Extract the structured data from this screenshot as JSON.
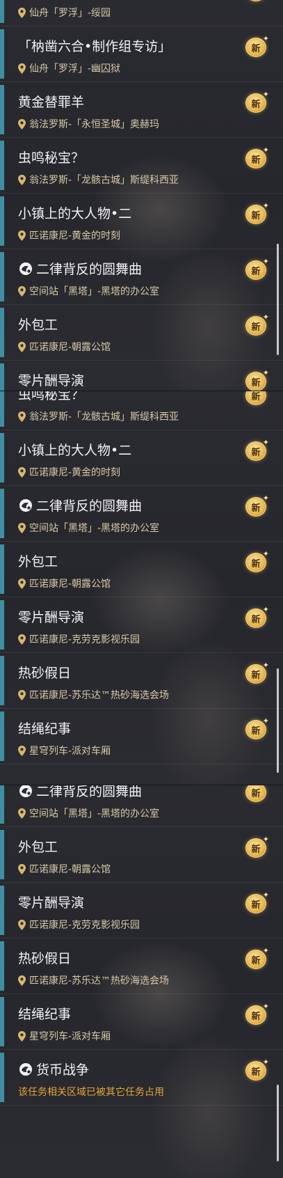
{
  "badge_text": "新",
  "colors": {
    "accent_bar": "#3f8fa4",
    "title_text": "#f2f2f2",
    "location_text": "#d9c9a6",
    "warning_text": "#e3a637",
    "badge_gold": "#e6b54e"
  },
  "icons": {
    "location": "map-pin-icon",
    "quest_type": "companion-quest-icon",
    "badge": "new-badge-icon"
  },
  "panels": [
    {
      "items": [
        {
          "title": "",
          "location": "仙舟「罗浮」-绥园",
          "has_quest_icon": false
        },
        {
          "title": "「枘凿六合•制作组专访」",
          "location": "仙舟「罗浮」-幽囚狱",
          "has_quest_icon": false
        },
        {
          "title": "黄金替罪羊",
          "location": "翁法罗斯-「永恒圣城」奥赫玛",
          "has_quest_icon": false
        },
        {
          "title": "虫鸣秘宝？",
          "location": "翁法罗斯-「龙骸古城」斯缇科西亚",
          "has_quest_icon": false
        },
        {
          "title": "小镇上的大人物•二",
          "location": "匹诺康尼-黄金的时刻",
          "has_quest_icon": false
        },
        {
          "title": "二律背反的圆舞曲",
          "location": "空间站「黑塔」-黑塔的办公室",
          "has_quest_icon": true
        },
        {
          "title": "外包工",
          "location": "匹诺康尼-朝露公馆",
          "has_quest_icon": false
        },
        {
          "title": "零片酬导演",
          "location": "",
          "has_quest_icon": false
        }
      ]
    },
    {
      "items": [
        {
          "title": "虫鸣秘宝？",
          "location": "翁法罗斯-「龙骸古城」斯缇科西亚",
          "has_quest_icon": false
        },
        {
          "title": "小镇上的大人物•二",
          "location": "匹诺康尼-黄金的时刻",
          "has_quest_icon": false
        },
        {
          "title": "二律背反的圆舞曲",
          "location": "空间站「黑塔」-黑塔的办公室",
          "has_quest_icon": true
        },
        {
          "title": "外包工",
          "location": "匹诺康尼-朝露公馆",
          "has_quest_icon": false
        },
        {
          "title": "零片酬导演",
          "location": "匹诺康尼-克劳克影视乐园",
          "has_quest_icon": false
        },
        {
          "title": "热砂假日",
          "location": "匹诺康尼-苏乐达™热砂海选会场",
          "has_quest_icon": false
        },
        {
          "title": "结绳纪事",
          "location": "星穹列车-派对车厢",
          "has_quest_icon": false
        }
      ]
    },
    {
      "items": [
        {
          "title": "二律背反的圆舞曲",
          "location": "空间站「黑塔」-黑塔的办公室",
          "has_quest_icon": true
        },
        {
          "title": "外包工",
          "location": "匹诺康尼-朝露公馆",
          "has_quest_icon": false
        },
        {
          "title": "零片酬导演",
          "location": "匹诺康尼-克劳克影视乐园",
          "has_quest_icon": false
        },
        {
          "title": "热砂假日",
          "location": "匹诺康尼-苏乐达™热砂海选会场",
          "has_quest_icon": false
        },
        {
          "title": "结绳纪事",
          "location": "星穹列车-派对车厢",
          "has_quest_icon": false
        },
        {
          "title": "货币战争",
          "location": "",
          "warning": "该任务相关区域已被其它任务占用",
          "has_quest_icon": true
        }
      ]
    }
  ]
}
